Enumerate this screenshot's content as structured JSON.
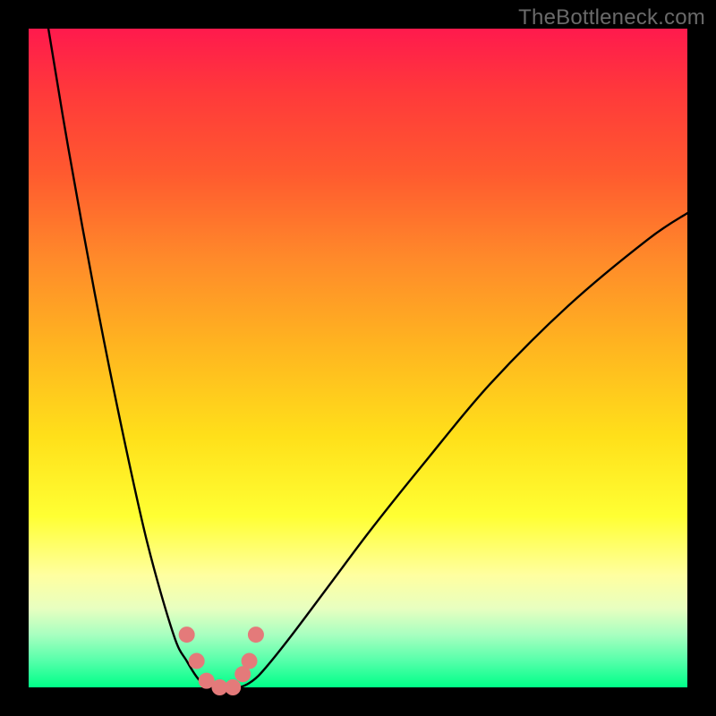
{
  "watermark": "TheBottleneck.com",
  "colors": {
    "background": "#000000",
    "curve": "#000000",
    "dots": "#e47a7a",
    "gradient_top": "#ff1a4d",
    "gradient_bottom": "#00ff88"
  },
  "chart_data": {
    "type": "line",
    "title": "",
    "xlabel": "",
    "ylabel": "",
    "xlim": [
      0,
      100
    ],
    "ylim": [
      0,
      100
    ],
    "series": [
      {
        "name": "bottleneck-curve",
        "x": [
          3,
          6,
          10,
          14,
          18,
          22,
          24,
          26,
          28,
          30,
          32,
          34,
          36,
          40,
          46,
          52,
          60,
          70,
          82,
          94,
          100
        ],
        "y": [
          100,
          82,
          60,
          40,
          22,
          8,
          4,
          1,
          0,
          0,
          0,
          1,
          3,
          8,
          16,
          24,
          34,
          46,
          58,
          68,
          72
        ]
      }
    ],
    "dots": {
      "name": "highlight-dots",
      "x": [
        24,
        25.5,
        27,
        29,
        31,
        32.5,
        33.5,
        34.5
      ],
      "y": [
        8,
        4,
        1,
        0,
        0,
        2,
        4,
        8
      ]
    }
  }
}
